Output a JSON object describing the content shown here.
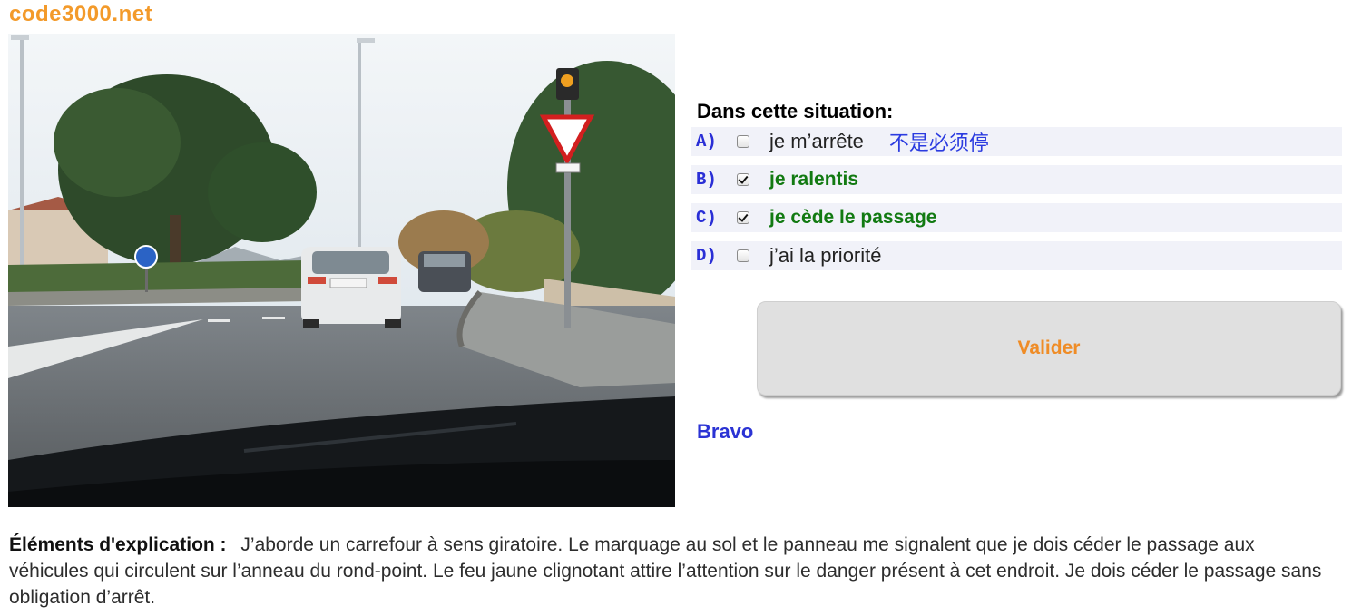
{
  "site": {
    "logo": "code3000.net"
  },
  "question": {
    "prompt": "Dans cette situation:"
  },
  "answers": [
    {
      "letter": "A)",
      "text": "je m’arrête",
      "checked": false,
      "correct": false,
      "hint": "不是必须停"
    },
    {
      "letter": "B)",
      "text": "je ralentis",
      "checked": true,
      "correct": true
    },
    {
      "letter": "C)",
      "text": "je cède le passage",
      "checked": true,
      "correct": true
    },
    {
      "letter": "D)",
      "text": "j’ai la priorité",
      "checked": false,
      "correct": false
    }
  ],
  "actions": {
    "validate_label": "Valider"
  },
  "result": {
    "message": "Bravo"
  },
  "explanation": {
    "lead": "Éléments d'explication :",
    "body": "J’aborde un carrefour à sens giratoire. Le marquage au sol et le panneau me signalent que je dois céder le passage aux véhicules qui circulent sur l’anneau du rond-point. Le feu jaune clignotant attire l’attention sur le danger présent à cet endroit. Je dois céder le passage sans obligation d’arrêt."
  },
  "colors": {
    "logo": "#f39a2a",
    "letter": "#2a2fd6",
    "correct_answer": "#127a12",
    "hint": "#2b3be0",
    "validate_text": "#ef8c26",
    "result": "#2b33d4",
    "row_background": "#f1f2f9"
  }
}
